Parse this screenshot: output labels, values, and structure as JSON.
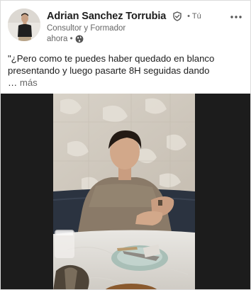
{
  "author": {
    "name": "Adrian Sanchez Torrubia",
    "degree": "• Tú",
    "headline": "Consultor y Formador",
    "time": "ahora •"
  },
  "icons": {
    "verified": "verified-badge-icon",
    "visibility": "globe-icon",
    "more": "more-options-icon"
  },
  "post": {
    "line1": "\"¿Pero como te puedes haber quedado en blanco",
    "line2": "presentando y luego pasarte 8H seguidas dando",
    "ellipsis": "…",
    "see_more": "más"
  },
  "colors": {
    "text_primary": "#1d1d1d",
    "text_secondary": "#666666",
    "card_bg": "#ffffff",
    "media_bg": "#1c1c1c"
  }
}
